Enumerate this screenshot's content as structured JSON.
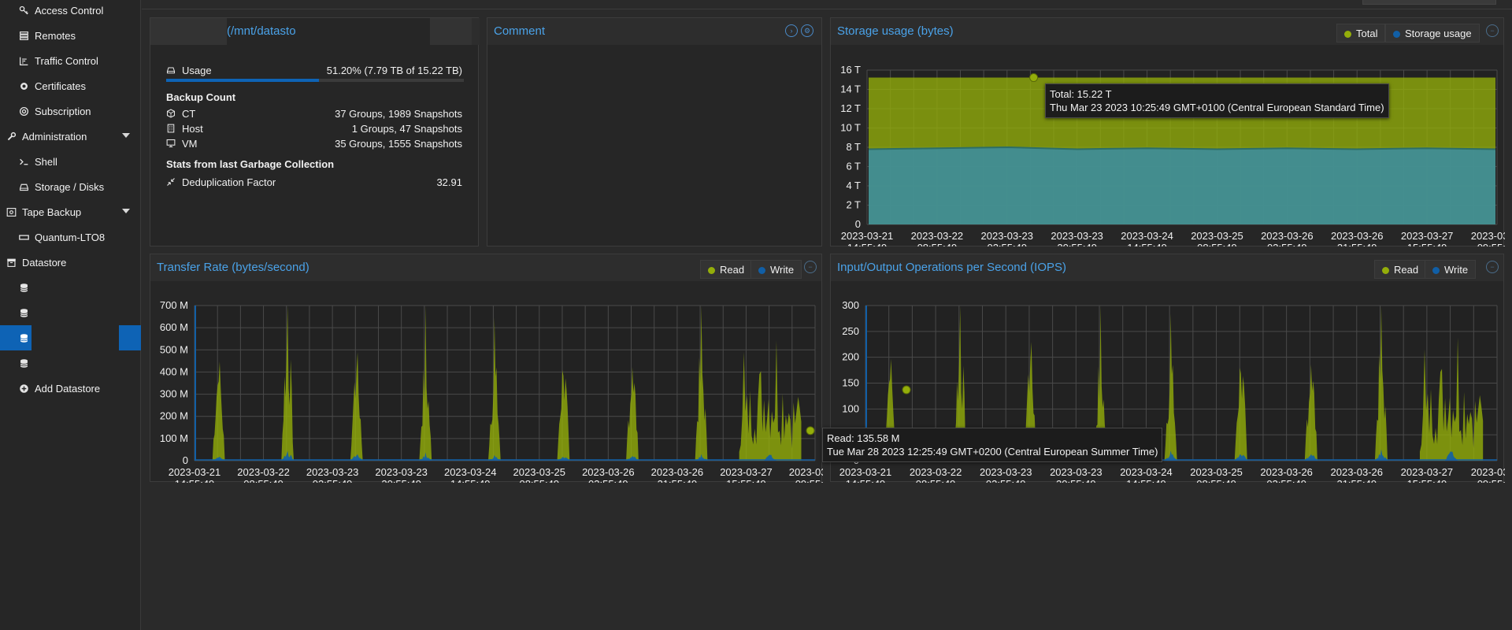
{
  "sidebar": {
    "items": [
      {
        "label": "Access Control",
        "icon": "key-icon"
      },
      {
        "label": "Remotes",
        "icon": "server-icon"
      },
      {
        "label": "Traffic Control",
        "icon": "traffic-chart-icon"
      },
      {
        "label": "Certificates",
        "icon": "certificate-icon"
      },
      {
        "label": "Subscription",
        "icon": "support-icon"
      },
      {
        "label": "Administration",
        "icon": "wrench-icon"
      },
      {
        "label": "Shell",
        "icon": "terminal-icon"
      },
      {
        "label": "Storage / Disks",
        "icon": "hdd-icon"
      },
      {
        "label": "Tape Backup",
        "icon": "tape-icon"
      },
      {
        "label": "Quantum-LTO8",
        "icon": "tape-drive-icon"
      },
      {
        "label": "Datastore",
        "icon": "archive-icon"
      },
      {
        "label": "Add Datastore",
        "icon": "plus-circle-icon"
      }
    ]
  },
  "summary": {
    "path": "(/mnt/datasto",
    "usage_label": "Usage",
    "usage_value": "51.20% (7.79 TB of 15.22 TB)",
    "usage_fraction": 0.512,
    "backup_count_label": "Backup Count",
    "ct_label": "CT",
    "ct_value": "37 Groups, 1989 Snapshots",
    "host_label": "Host",
    "host_value": "1 Groups, 47 Snapshots",
    "vm_label": "VM",
    "vm_value": "35 Groups, 1555 Snapshots",
    "gc_label": "Stats from last Garbage Collection",
    "dedup_label": "Deduplication Factor",
    "dedup_value": "32.91"
  },
  "comment": {
    "title": "Comment"
  },
  "storage": {
    "title": "Storage usage (bytes)",
    "legend_total": "Total",
    "legend_usage": "Storage usage",
    "tooltip_line1": "Total: 15.22 T",
    "tooltip_line2": "Thu Mar 23 2023 10:25:49 GMT+0100 (Central European Standard Time)"
  },
  "transfer": {
    "title": "Transfer Rate (bytes/second)",
    "legend_read": "Read",
    "legend_write": "Write",
    "tooltip_line1": "Read: 135.58 M",
    "tooltip_line2": "Tue Mar 28 2023 12:25:49 GMT+0200 (Central European Summer Time)"
  },
  "iops": {
    "title": "Input/Output Operations per Second (IOPS)",
    "legend_read": "Read",
    "legend_write": "Write"
  },
  "colors": {
    "read": "#94ae0a",
    "write": "#115fa6",
    "accent": "#4aa2e8",
    "selected": "#0e63b5",
    "total": "#94ae0a",
    "usage": "#3d8d9c"
  },
  "chart_data": [
    {
      "type": "area",
      "title": "Storage usage (bytes)",
      "x_ticks": [
        "2023-03-21 14:55:49",
        "2023-03-22 08:55:49",
        "2023-03-23 02:55:49",
        "2023-03-23 20:55:49",
        "2023-03-24 14:55:49",
        "2023-03-25 08:55:49",
        "2023-03-26 03:55:49",
        "2023-03-26 21:55:49",
        "2023-03-27 15:55:49",
        "2023-03-28 09:55:49"
      ],
      "y_ticks": [
        "0",
        "2 T",
        "4 T",
        "6 T",
        "8 T",
        "10 T",
        "12 T",
        "14 T",
        "16 T"
      ],
      "ylim": [
        0,
        16
      ],
      "series": [
        {
          "name": "Total",
          "values": [
            15.22,
            15.22,
            15.22,
            15.22,
            15.22,
            15.22,
            15.22,
            15.22,
            15.22,
            15.22
          ]
        },
        {
          "name": "Storage usage",
          "values": [
            7.8,
            7.9,
            8.0,
            7.8,
            7.9,
            7.8,
            7.9,
            7.8,
            7.9,
            7.8
          ]
        }
      ]
    },
    {
      "type": "area",
      "title": "Transfer Rate (bytes/second)",
      "x_ticks": [
        "2023-03-21 14:55:49",
        "2023-03-22 08:55:49",
        "2023-03-23 02:55:49",
        "2023-03-23 20:55:49",
        "2023-03-24 14:55:49",
        "2023-03-25 08:55:49",
        "2023-03-26 03:55:49",
        "2023-03-26 21:55:49",
        "2023-03-27 15:55:49",
        "2023-03-28 09:55:49"
      ],
      "y_ticks": [
        "0",
        "100 M",
        "200 M",
        "300 M",
        "400 M",
        "500 M",
        "600 M",
        "700 M"
      ],
      "ylim": [
        0,
        700
      ],
      "peaks_read": [
        500,
        670,
        510,
        500,
        500,
        500,
        500,
        540,
        660
      ],
      "peaks_write": [
        20,
        40,
        30,
        25,
        20,
        20,
        25,
        20,
        30
      ]
    },
    {
      "type": "area",
      "title": "Input/Output Operations per Second (IOPS)",
      "x_ticks": [
        "2023-03-21 14:55:49",
        "2023-03-22 08:55:49",
        "2023-03-23 02:55:49",
        "2023-03-23 20:55:49",
        "2023-03-24 14:55:49",
        "2023-03-25 08:55:49",
        "2023-03-26 03:55:49",
        "2023-03-26 21:55:49",
        "2023-03-27 15:55:49",
        "2023-03-28 09:55:49"
      ],
      "y_ticks": [
        "0",
        "50",
        "100",
        "150",
        "200",
        "250",
        "300"
      ],
      "ylim": [
        0,
        300
      ],
      "peaks_read": [
        220,
        270,
        240,
        220,
        220,
        220,
        220,
        240,
        290
      ],
      "peaks_write": [
        15,
        20,
        15,
        15,
        15,
        15,
        15,
        15,
        20
      ]
    }
  ]
}
